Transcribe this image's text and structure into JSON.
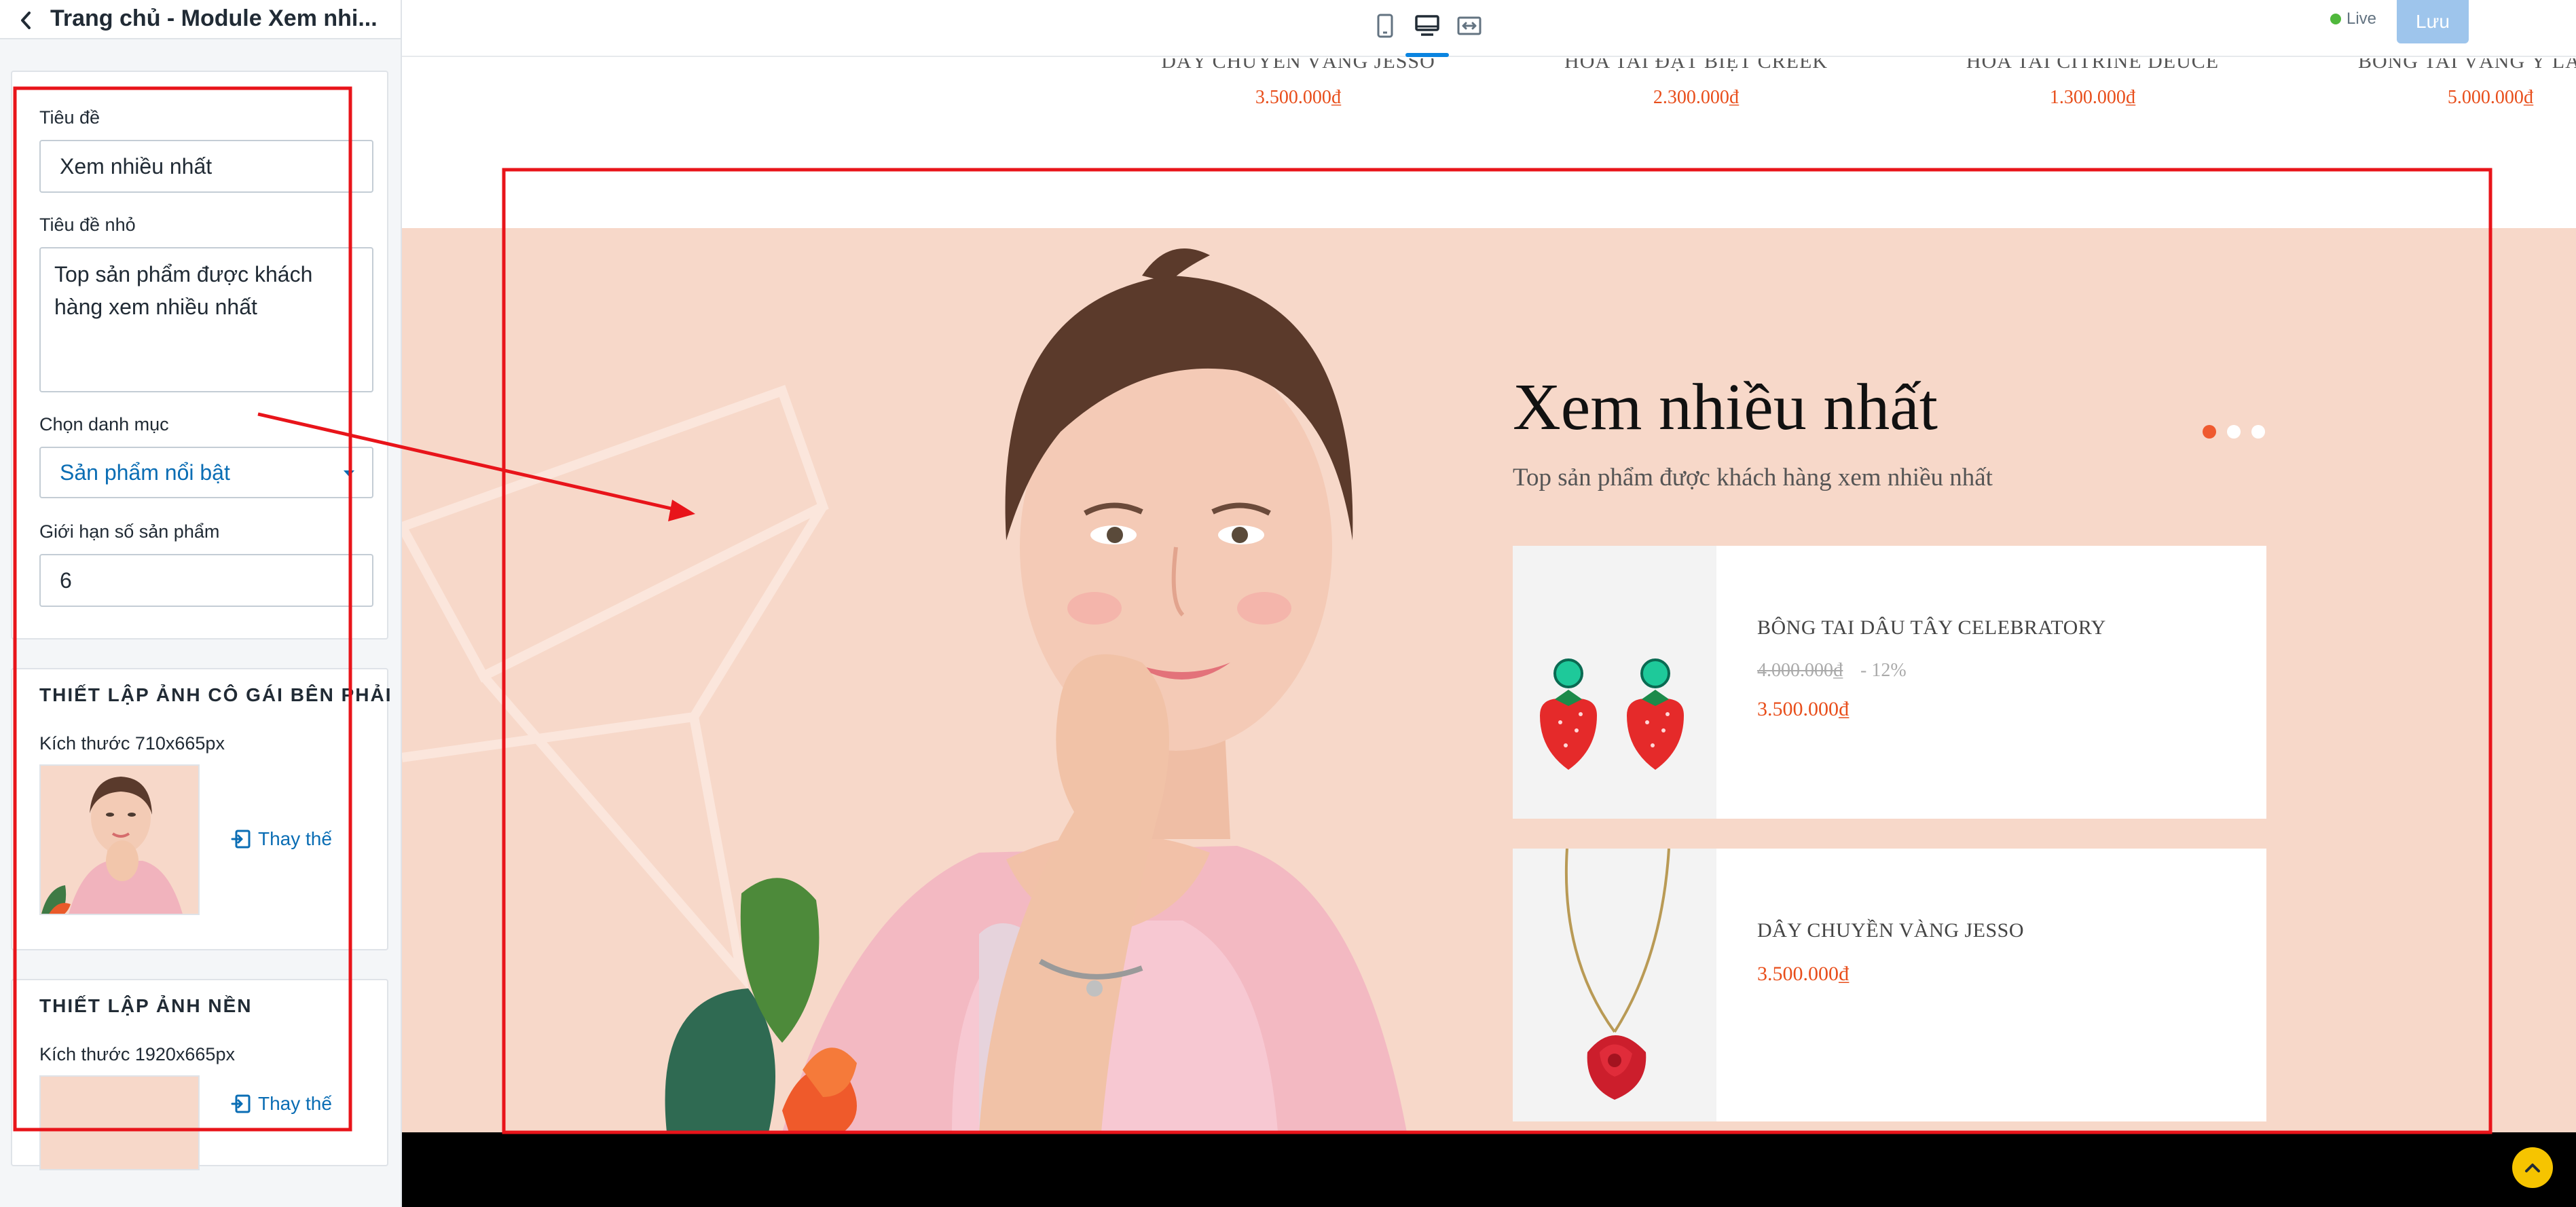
{
  "sidebar": {
    "title": "Trang chủ - Module Xem nhi...",
    "general": {
      "title_label": "Tiêu đề",
      "title_value": "Xem nhiều nhất",
      "subtitle_label": "Tiêu đề nhỏ",
      "subtitle_value": "Top sản phẩm được khách hàng xem nhiều nhất",
      "category_label": "Chọn danh mục",
      "category_value": "Sản phẩm nổi bật",
      "limit_label": "Giới hạn số sản phẩm",
      "limit_value": "6"
    },
    "girl_image": {
      "heading": "THIẾT LẬP ẢNH CÔ GÁI BÊN PHẢI",
      "size_text": "Kích thước 710x665px",
      "replace_label": "Thay thế"
    },
    "bg_image": {
      "heading": "THIẾT LẬP ẢNH NỀN",
      "size_text": "Kích thước 1920x665px",
      "replace_label": "Thay thế"
    }
  },
  "toolbar": {
    "devices": [
      "mobile-icon",
      "desktop-icon",
      "fullwidth-icon"
    ],
    "active_device": "desktop-icon",
    "live_label": "Live",
    "save_label": "Lưu"
  },
  "preview": {
    "top_products": [
      {
        "name": "DÂY CHUYỀN VÀNG JESSO",
        "price": "3.500.000₫"
      },
      {
        "name": "HOA TAI ĐẶT BIỆT CREEK",
        "price": "2.300.000₫"
      },
      {
        "name": "HOA TAI CITRINE DEUCE",
        "price": "1.300.000₫"
      },
      {
        "name": "BÔNG TAI VÀNG Ý LANTA",
        "price": "5.000.000₫"
      }
    ],
    "section": {
      "title": "Xem nhiều nhất",
      "subtitle": "Top sản phẩm được khách hàng xem nhiều nhất",
      "dots_count": 3,
      "active_dot": 0,
      "products": [
        {
          "name": "BÔNG TAI DÂU TÂY CELEBRATORY",
          "old_price": "4.000.000₫",
          "discount": "- 12%",
          "price": "3.500.000₫",
          "image": "strawberry-earrings"
        },
        {
          "name": "DÂY CHUYỀN VÀNG JESSO",
          "price": "3.500.000₫",
          "image": "rose-necklace"
        }
      ]
    }
  },
  "colors": {
    "accent_blue": "#0a6db4",
    "price_orange": "#e84e1b",
    "section_bg": "#f7d8c9",
    "annotation_red": "#e8141a",
    "save_button": "#9ec5ec",
    "live_green": "#50b83c"
  }
}
